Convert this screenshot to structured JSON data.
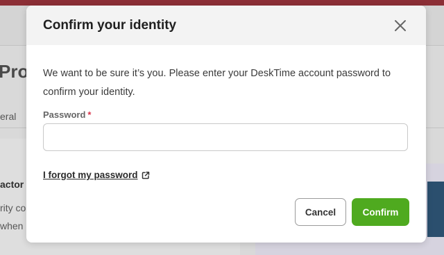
{
  "background": {
    "page_title_fragment": "Prof",
    "tab_fragment": "eral",
    "text_fragment_1": "actor a",
    "text_fragment_2": "rity co",
    "text_fragment_3": "when"
  },
  "modal": {
    "title": "Confirm your identity",
    "description": "We want to be sure it’s you. Please enter your DeskTime account password to confirm your identity.",
    "password_label": "Password",
    "required_marker": "*",
    "password_value": "",
    "forgot_link": "I forgot my password",
    "cancel_label": "Cancel",
    "confirm_label": "Confirm"
  },
  "icons": {
    "close": "close-icon",
    "external_link": "external-link-icon"
  },
  "colors": {
    "confirm_button": "#4faa1f",
    "required_marker": "#d9334a",
    "top_bar": "#8c2f36"
  }
}
